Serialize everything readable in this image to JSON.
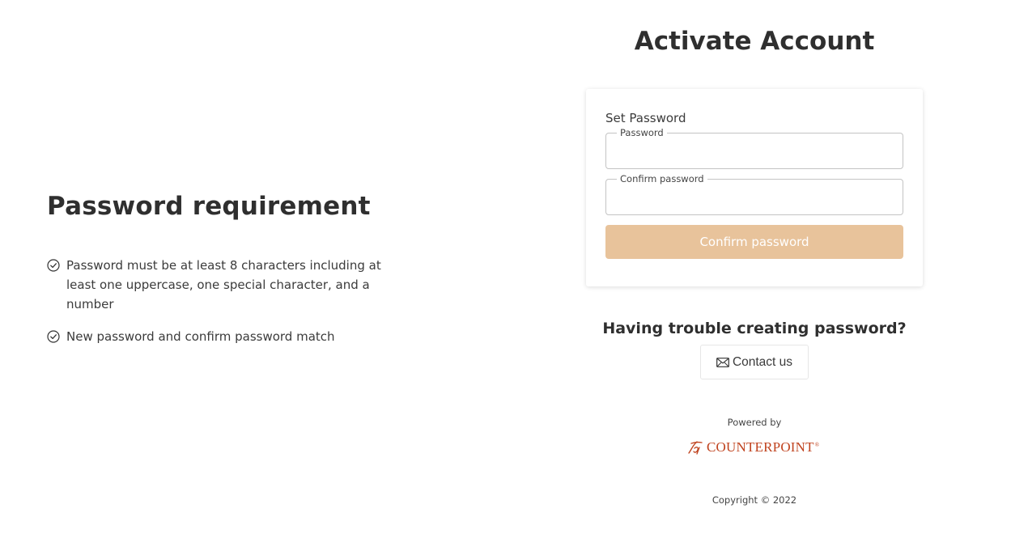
{
  "requirements": {
    "title": "Password requirement",
    "items": [
      {
        "text": "Password must be at least 8 characters including at least one uppercase, one special character, and a number",
        "icon": "check-circle-icon"
      },
      {
        "text": "New password and confirm password match",
        "icon": "check-circle-icon"
      }
    ]
  },
  "activate": {
    "title": "Activate Account",
    "card_title": "Set Password",
    "password_label": "Password",
    "password_value": "",
    "confirm_label": "Confirm password",
    "confirm_value": "",
    "submit_label": "Confirm password"
  },
  "help": {
    "trouble_text": "Having trouble creating password?",
    "contact_label": "Contact us",
    "contact_icon": "envelope-icon"
  },
  "footer": {
    "powered_by": "Powered by",
    "brand_name": "COUNTERPOINT",
    "brand_mark": "®",
    "copyright": "Copyright © 2022"
  },
  "colors": {
    "accent_disabled": "#e8c39b",
    "brand": "#c0431f",
    "text": "#333333"
  }
}
